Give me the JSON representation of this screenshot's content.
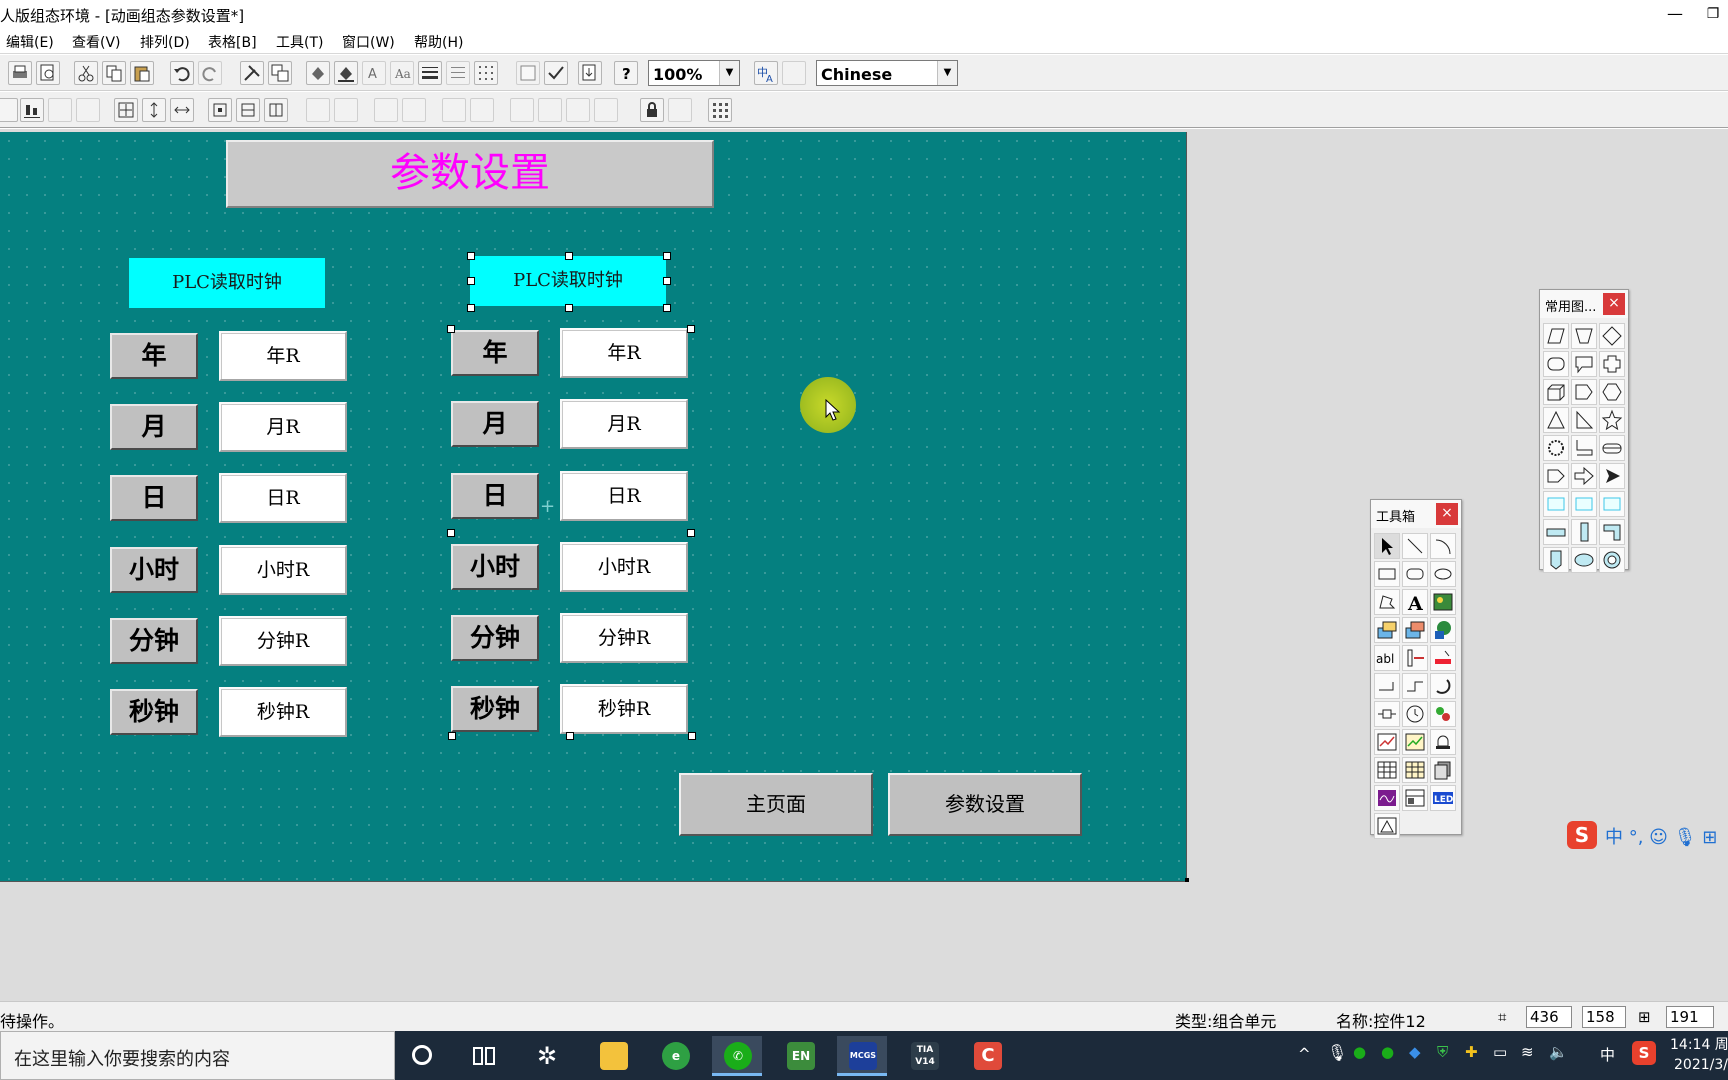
{
  "window": {
    "title": "人版组态环境 - [动画组态参数设置*]",
    "minimize": "—",
    "maximize": "❐"
  },
  "menu": [
    "编辑(E)",
    "查看(V)",
    "排列(D)",
    "表格[B]",
    "工具(T)",
    "窗口(W)",
    "帮助(H)"
  ],
  "toolbar": {
    "zoom": "100%",
    "language": "Chinese"
  },
  "screen": {
    "title": "参数设置",
    "plc_left": "PLC读取时钟",
    "plc_right": "PLC读取时钟",
    "labels": [
      "年",
      "月",
      "日",
      "小时",
      "分钟",
      "秒钟"
    ],
    "fields": [
      "年R",
      "月R",
      "日R",
      "小时R",
      "分钟R",
      "秒钟R"
    ],
    "nav_main": "主页面",
    "nav_params": "参数设置"
  },
  "palettes": {
    "common_shapes_title": "常用图...",
    "toolbox_title": "工具箱",
    "close": "×"
  },
  "ime": {
    "logo": "S",
    "text": "中 °, ☺ 🎙 ⊞"
  },
  "status": {
    "message": "待操作。",
    "type": "类型:组合单元",
    "name": "名称:控件12",
    "x": "436",
    "y": "158",
    "w": "191"
  },
  "taskbar": {
    "search_placeholder": "在这里输入你要搜索的内容",
    "apps": [
      "EN",
      "MCGS",
      "TIA V14",
      "C"
    ],
    "tray_ime": "中",
    "time": "14:14 周",
    "date": "2021/3/"
  }
}
